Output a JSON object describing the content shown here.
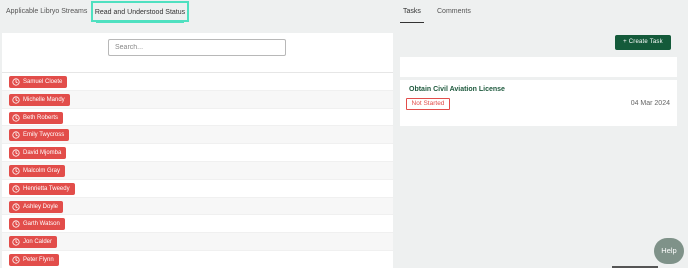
{
  "left_tabs": [
    {
      "label": "Applicable Libryo Streams"
    },
    {
      "label": "Read and Understood Status"
    }
  ],
  "search": {
    "placeholder": "Search...",
    "value": ""
  },
  "users": [
    {
      "name": "Samuel Cloete"
    },
    {
      "name": "Michelle Mandy"
    },
    {
      "name": "Beth Roberts"
    },
    {
      "name": "Emily Twycross"
    },
    {
      "name": "David Mjomba"
    },
    {
      "name": "Malcolm Gray"
    },
    {
      "name": "Henrietta Tweedy"
    },
    {
      "name": "Ashley Doyle"
    },
    {
      "name": "Garth Watson"
    },
    {
      "name": "Jon Calder"
    },
    {
      "name": "Peter Flynn"
    }
  ],
  "right_tabs": [
    {
      "label": "Tasks"
    },
    {
      "label": "Comments"
    }
  ],
  "create_task": {
    "label": "+ Create Task"
  },
  "task": {
    "title": "Obtain Civil Aviation License",
    "status": "Not Started",
    "date": "04 Mar 2024"
  },
  "help": {
    "label": "Help"
  },
  "colors": {
    "accent_tab": "#4fe0c0",
    "badge_red": "#e24d4a",
    "primary_green": "#145a3a",
    "task_title_green": "#1f5a3e"
  },
  "icons": {
    "user_badge_icon": "clock-icon"
  }
}
